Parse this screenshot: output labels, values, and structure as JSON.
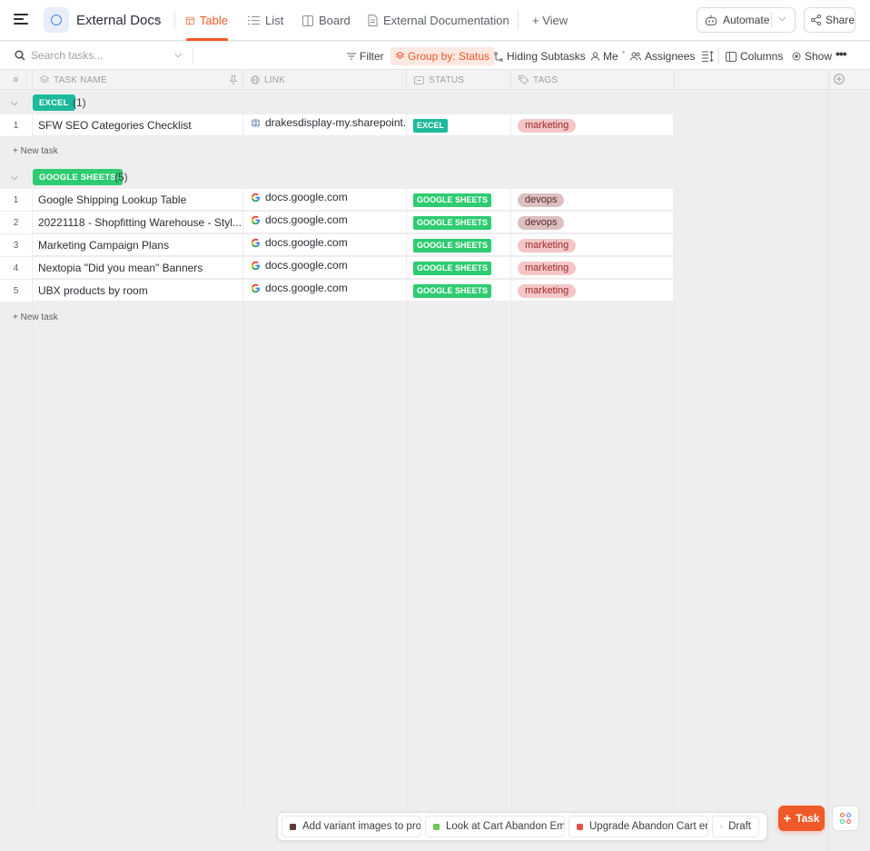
{
  "header": {
    "space_title": "External Docs",
    "tabs": [
      {
        "label": "Table",
        "icon": "table-icon",
        "active": true
      },
      {
        "label": "List",
        "icon": "list-icon"
      },
      {
        "label": "Board",
        "icon": "board-icon"
      },
      {
        "label": "External Documentation",
        "icon": "doc-icon"
      }
    ],
    "add_view_label": "+ View",
    "automate_label": "Automate",
    "share_label": "Share"
  },
  "toolbar": {
    "search_placeholder": "Search tasks...",
    "filter_label": "Filter",
    "group_by_label": "Group by: Status",
    "hiding_subtasks_label": "Hiding Subtasks",
    "me_label": "Me",
    "assignees_label": "Assignees",
    "columns_label": "Columns",
    "show_label": "Show"
  },
  "table": {
    "columns": [
      "#",
      "TASK NAME",
      "LINK",
      "STATUS",
      "TAGS"
    ],
    "groups": [
      {
        "label": "EXCEL",
        "count": "(1)",
        "color": "#1db99a",
        "rows": [
          {
            "num": "1",
            "name": "SFW SEO Categories Checklist",
            "link": "drakesdisplay-my.sharepoint.c",
            "link_icon": "globe-icon",
            "status": "EXCEL",
            "tag": "marketing"
          }
        ]
      },
      {
        "label": "GOOGLE SHEETS",
        "count": "(5)",
        "color": "#2ecc71",
        "rows": [
          {
            "num": "1",
            "name": "Google Shipping Lookup Table",
            "link": "docs.google.com",
            "link_icon": "google-icon",
            "status": "GOOGLE SHEETS",
            "tag": "devops"
          },
          {
            "num": "2",
            "name": "20221118 - Shopfitting Warehouse - Styl...",
            "link": "docs.google.com",
            "link_icon": "google-icon",
            "status": "GOOGLE SHEETS",
            "tag": "devops"
          },
          {
            "num": "3",
            "name": "Marketing Campaign Plans",
            "link": "docs.google.com",
            "link_icon": "google-icon",
            "status": "GOOGLE SHEETS",
            "tag": "marketing"
          },
          {
            "num": "4",
            "name": "Nextopia \"Did you mean\" Banners",
            "link": "docs.google.com",
            "link_icon": "google-icon",
            "status": "GOOGLE SHEETS",
            "tag": "marketing"
          },
          {
            "num": "5",
            "name": "UBX products by room",
            "link": "docs.google.com",
            "link_icon": "google-icon",
            "status": "GOOGLE SHEETS",
            "tag": "marketing"
          }
        ]
      }
    ],
    "new_task_label": "+ New task"
  },
  "dock": {
    "items": [
      {
        "label": "Add variant images to prod",
        "color": "#5a3b3b"
      },
      {
        "label": "Look at Cart Abandon Ema",
        "color": "#6bc950"
      },
      {
        "label": "Upgrade Abandon Cart em",
        "color": "#e44f4f"
      }
    ],
    "draft_label": "Draft",
    "task_button_label": "Task"
  },
  "colors": {
    "accent": "#f05a28",
    "excel": "#1db99a",
    "google_sheets": "#2ecc71"
  }
}
